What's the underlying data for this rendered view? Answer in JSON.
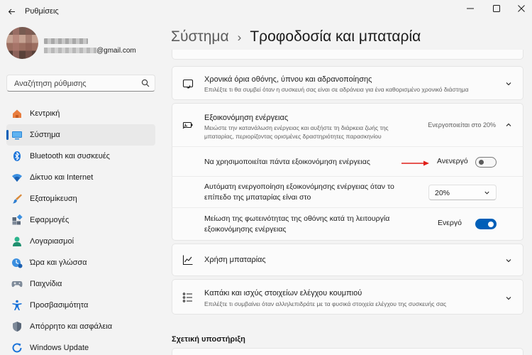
{
  "window": {
    "title": "Ρυθμίσεις"
  },
  "profile": {
    "email": "@gmail.com"
  },
  "search": {
    "placeholder": "Αναζήτηση ρύθμισης"
  },
  "nav": {
    "items": [
      {
        "label": "Κεντρική",
        "icon": "home-icon"
      },
      {
        "label": "Σύστημα",
        "icon": "system-icon",
        "active": true
      },
      {
        "label": "Bluetooth και συσκευές",
        "icon": "bluetooth-icon"
      },
      {
        "label": "Δίκτυο και Internet",
        "icon": "wifi-icon"
      },
      {
        "label": "Εξατομίκευση",
        "icon": "brush-icon"
      },
      {
        "label": "Εφαρμογές",
        "icon": "apps-icon"
      },
      {
        "label": "Λογαριασμοί",
        "icon": "account-icon"
      },
      {
        "label": "Ώρα και γλώσσα",
        "icon": "time-language-icon"
      },
      {
        "label": "Παιχνίδια",
        "icon": "gamepad-icon"
      },
      {
        "label": "Προσβασιμότητα",
        "icon": "accessibility-icon"
      },
      {
        "label": "Απόρρητο και ασφάλεια",
        "icon": "shield-icon"
      },
      {
        "label": "Windows Update",
        "icon": "update-icon"
      }
    ]
  },
  "header": {
    "breadcrumb_parent": "Σύστημα",
    "separator": "›",
    "title": "Τροφοδοσία και μπαταρία"
  },
  "cards": {
    "screen_timeouts": {
      "title": "Χρονικά όρια οθόνης, ύπνου και αδρανοποίησης",
      "subtitle": "Επιλέξτε τι θα συμβεί όταν η συσκευή σας είναι σε αδράνεια για ένα καθορισμένο χρονικό διάστημα"
    },
    "battery_saver": {
      "title": "Εξοικονόμηση ενέργειας",
      "subtitle_line1": "Μειώστε την κατανάλωση ενέργειας και αυξήστε τη διάρκεια ζωής της",
      "subtitle_line2": "μπαταρίας, περιορίζοντας ορισμένες δραστηριότητες παρασκηνίου",
      "status": "Ενεργοποιείται στο 20%",
      "rows": {
        "always_on": {
          "label": "Να χρησιμοποιείται πάντα εξοικονόμηση ενέργειας",
          "state": "Ανενεργό",
          "on": false
        },
        "auto_on": {
          "label_line1": "Αυτόματη ενεργοποίηση εξοικονόμησης ενέργειας όταν το",
          "label_line2": "επίπεδο της μπαταρίας είναι στο",
          "selected": "20%"
        },
        "brightness": {
          "label_line1": "Μείωση της φωτεινότητας της οθόνης κατά τη λειτουργία",
          "label_line2": "εξοικονόμησης ενέργειας",
          "state": "Ενεργό",
          "on": true
        }
      }
    },
    "battery_usage": {
      "title": "Χρήση μπαταρίας"
    },
    "lid_power": {
      "title": "Καπάκι και ισχύς στοιχείων ελέγχου κουμπιού",
      "subtitle": "Επιλέξτε τι συμβαίνει όταν αλληλεπιδράτε με τα φυσικά στοιχεία ελέγχου της συσκευής σας"
    }
  },
  "related": {
    "heading": "Σχετική υποστήριξη"
  },
  "colors": {
    "accent": "#005fb8",
    "annotation_arrow": "#e0201a"
  }
}
